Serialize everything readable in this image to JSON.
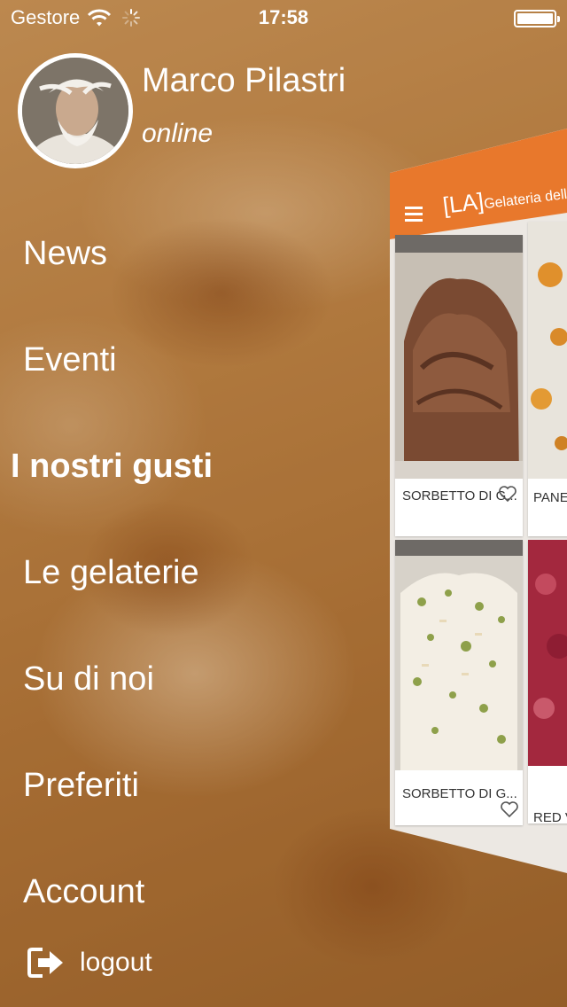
{
  "status_bar": {
    "carrier": "Gestore",
    "time": "17:58"
  },
  "profile": {
    "name": "Marco Pilastri",
    "status": "online"
  },
  "menu": {
    "items": [
      {
        "label": "News"
      },
      {
        "label": "Eventi"
      },
      {
        "label": "I nostri gusti",
        "active": true
      },
      {
        "label": "Le gelaterie"
      },
      {
        "label": "Su di noi"
      },
      {
        "label": "Preferiti"
      },
      {
        "label": "Account"
      }
    ],
    "logout_label": "logout"
  },
  "preview": {
    "title_bracket": "[LA]",
    "title_rest": "Gelateria della M",
    "cards": [
      {
        "caption": "SORBETTO DI G..."
      },
      {
        "caption": "PANE I"
      },
      {
        "caption": "SORBETTO DI G..."
      },
      {
        "caption": "RED V"
      }
    ]
  },
  "colors": {
    "accent": "#e8782c",
    "menu_text": "#ffffff",
    "background_tint": "#b07a3e"
  },
  "icons": {
    "wifi": "wifi-icon",
    "activity": "spinner-icon",
    "battery": "battery-icon",
    "logout": "logout-icon",
    "menu": "hamburger-icon",
    "favorite": "heart-icon"
  }
}
